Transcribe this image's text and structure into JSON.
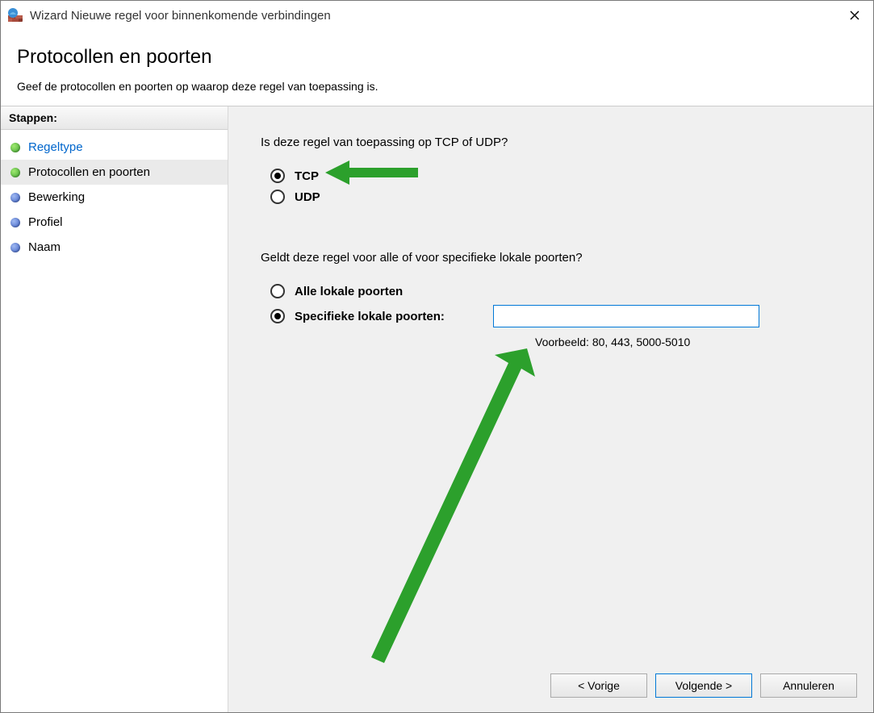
{
  "window": {
    "title": "Wizard Nieuwe regel voor binnenkomende verbindingen"
  },
  "header": {
    "title": "Protocollen en poorten",
    "subtitle": "Geef de protocollen en poorten op waarop deze regel van toepassing is."
  },
  "sidebar": {
    "header": "Stappen:",
    "steps": [
      {
        "label": "Regeltype",
        "state": "completed",
        "bullet": "green"
      },
      {
        "label": "Protocollen en poorten",
        "state": "current",
        "bullet": "green"
      },
      {
        "label": "Bewerking",
        "state": "todo",
        "bullet": "blue"
      },
      {
        "label": "Profiel",
        "state": "todo",
        "bullet": "blue"
      },
      {
        "label": "Naam",
        "state": "todo",
        "bullet": "blue"
      }
    ]
  },
  "content": {
    "q1": "Is deze regel van toepassing op TCP of UDP?",
    "opt_tcp": "TCP",
    "opt_udp": "UDP",
    "q2": "Geldt deze regel voor alle of voor specifieke lokale poorten?",
    "opt_all_ports": "Alle lokale poorten",
    "opt_specific_ports": "Specifieke lokale poorten:",
    "ports_value": "",
    "ports_example": "Voorbeeld: 80, 443, 5000-5010",
    "protocol_selected": "tcp",
    "ports_scope_selected": "specific"
  },
  "footer": {
    "back": "< Vorige",
    "next": "Volgende >",
    "cancel": "Annuleren"
  }
}
